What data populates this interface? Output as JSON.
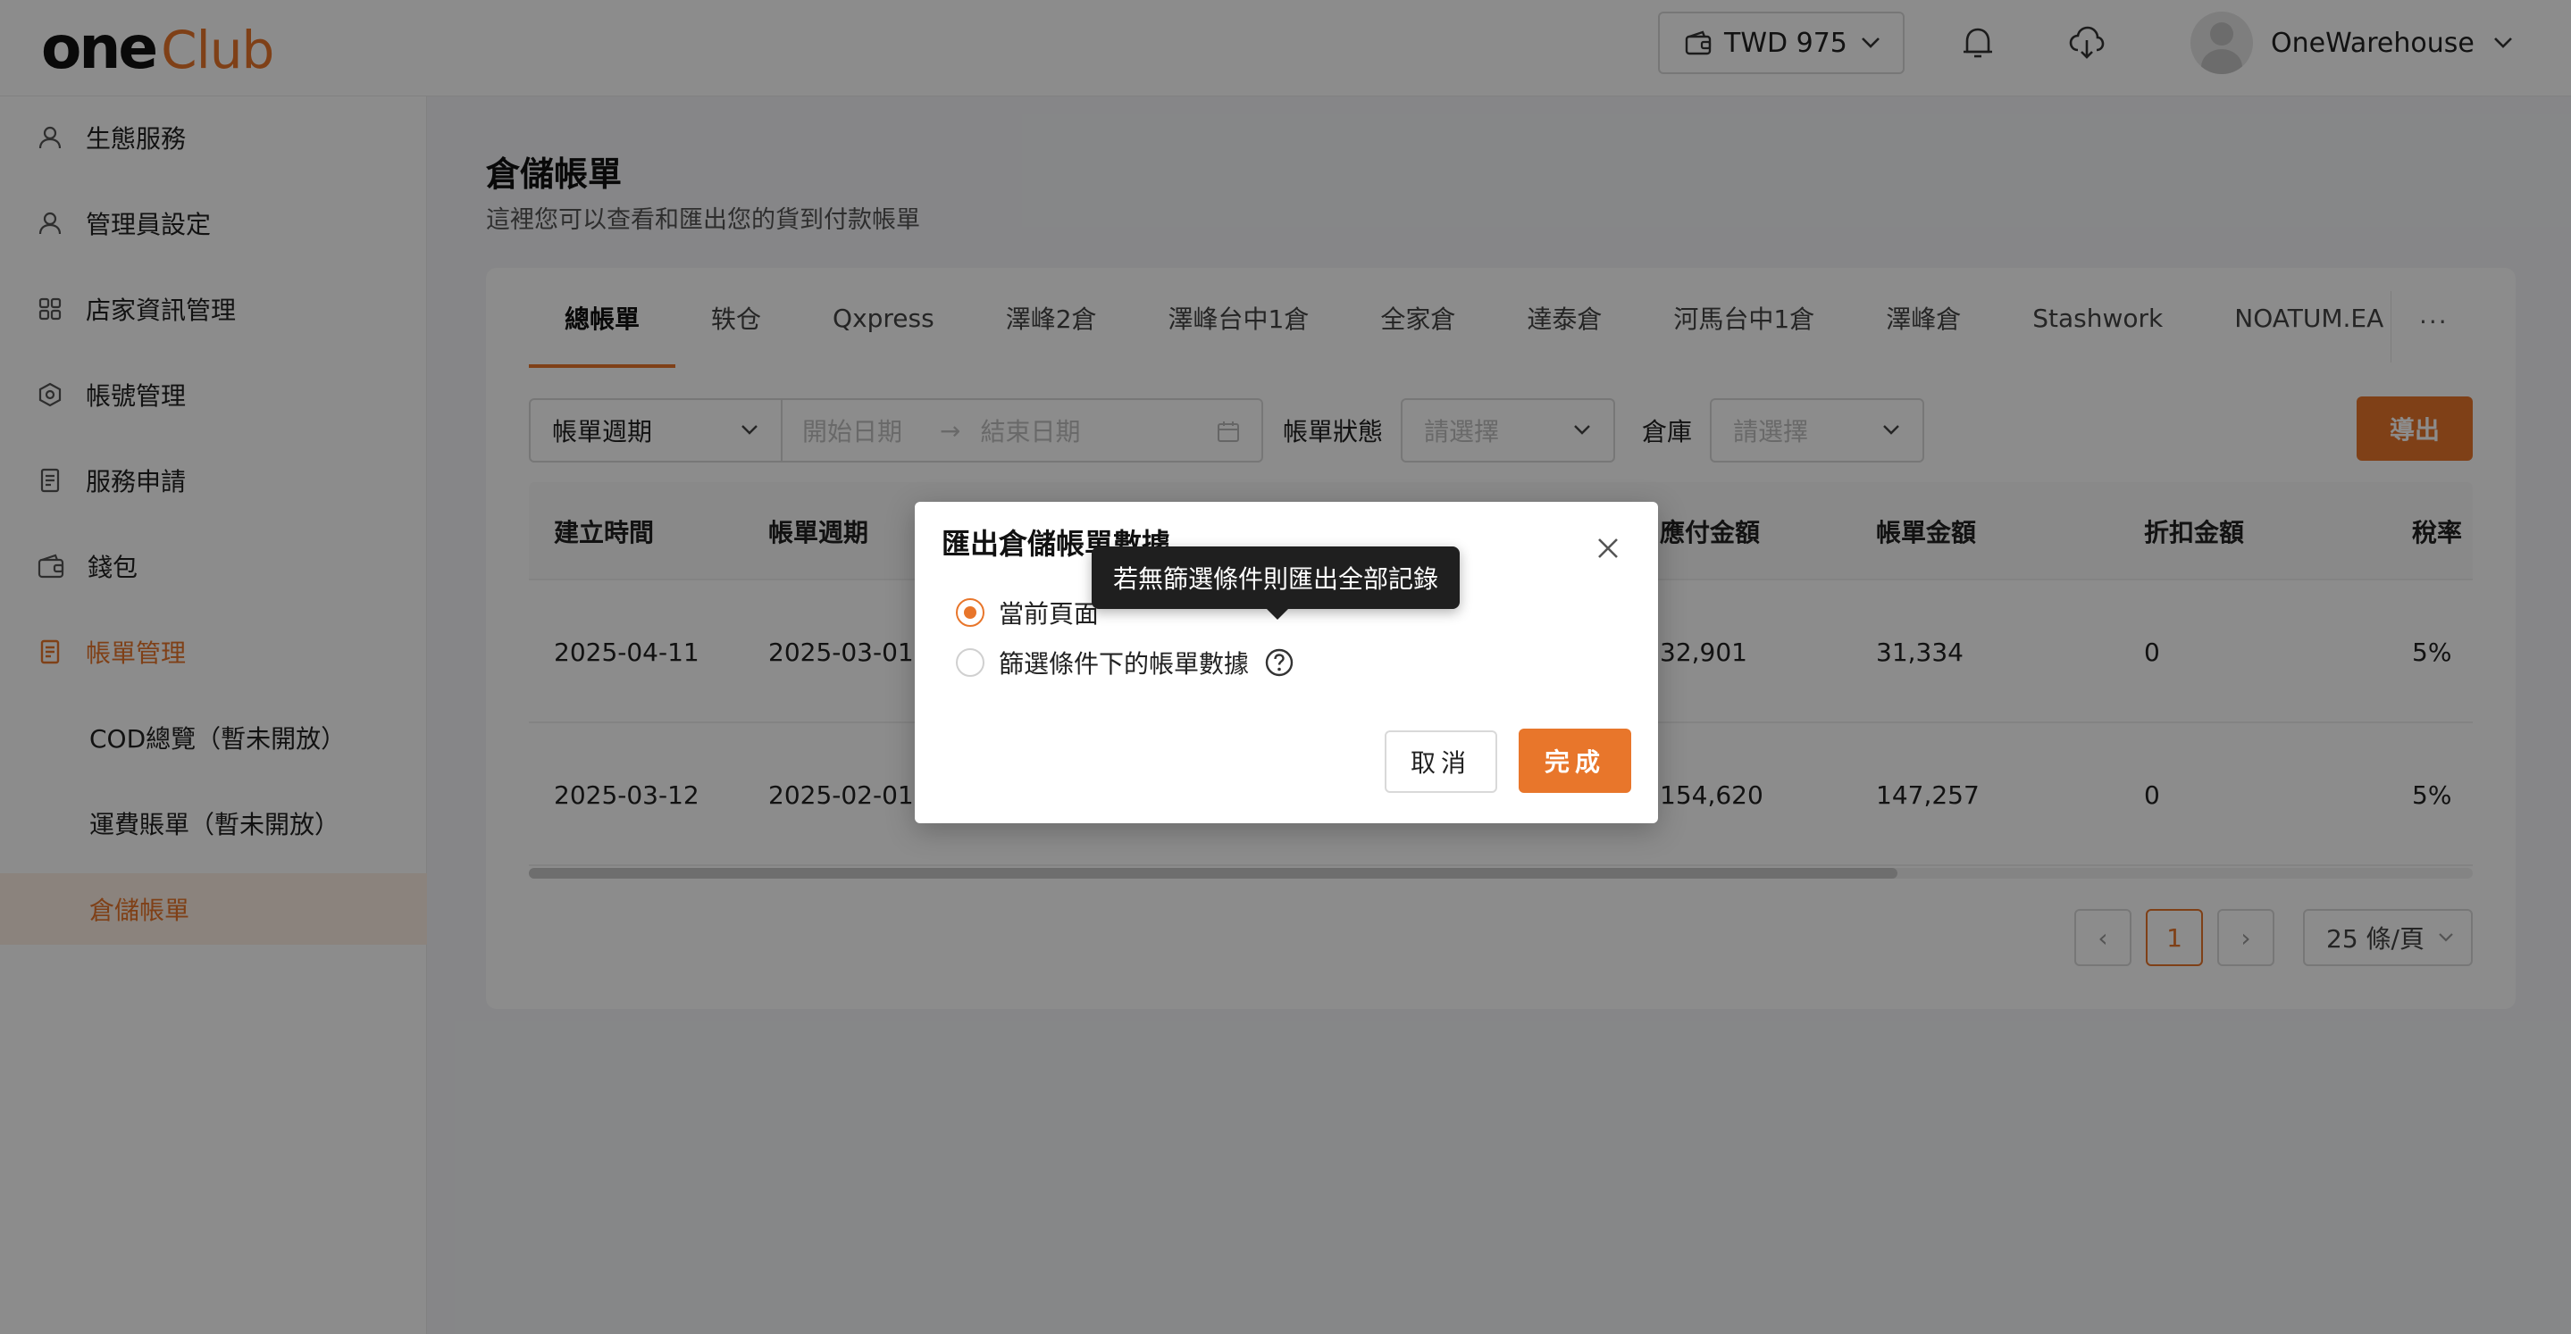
{
  "brand": {
    "logo_one": "one",
    "logo_club": "Club",
    "accent": "#e8762b"
  },
  "header": {
    "wallet_label": "TWD 975",
    "user_name": "OneWarehouse",
    "icons": [
      "wallet-icon",
      "bell-icon",
      "cloud-download-icon",
      "chevron-down-icon"
    ]
  },
  "sidebar": {
    "items": [
      {
        "label": "生態服務",
        "icon": "user-icon"
      },
      {
        "label": "管理員設定",
        "icon": "user-icon"
      },
      {
        "label": "店家資訊管理",
        "icon": "grid-icon"
      },
      {
        "label": "帳號管理",
        "icon": "hexagon-icon"
      },
      {
        "label": "服務申請",
        "icon": "document-icon"
      },
      {
        "label": "錢包",
        "icon": "wallet-icon"
      },
      {
        "label": "帳單管理",
        "icon": "bill-icon"
      }
    ],
    "subitems": [
      {
        "label": "COD總覽（暫未開放）"
      },
      {
        "label": "運費賬單（暫未開放）"
      },
      {
        "label": "倉儲帳單"
      }
    ]
  },
  "page": {
    "title": "倉儲帳單",
    "subtitle": "這裡您可以查看和匯出您的貨到付款帳單"
  },
  "tabs": [
    "總帳單",
    "轶仓",
    "Qxpress",
    "澤峰2倉",
    "澤峰台中1倉",
    "全家倉",
    "達泰倉",
    "河馬台中1倉",
    "澤峰倉",
    "Stashwork",
    "NOATUM.EA"
  ],
  "tabs_more": "···",
  "filters": {
    "period_select": "帳單週期",
    "start_placeholder": "開始日期",
    "end_placeholder": "結束日期",
    "arrow": "→",
    "status_label": "帳單狀態",
    "status_placeholder": "請選擇",
    "warehouse_label": "倉庫",
    "warehouse_placeholder": "請選擇",
    "export_button": "導出"
  },
  "table": {
    "columns": [
      "建立時間",
      "帳單週期",
      "應付金額",
      "帳單金額",
      "折扣金額",
      "稅率"
    ],
    "rows": [
      [
        "2025-04-11",
        "2025-03-01",
        "32,901",
        "31,334",
        "0",
        "5%"
      ],
      [
        "2025-03-12",
        "2025-02-01",
        "154,620",
        "147,257",
        "0",
        "5%"
      ]
    ]
  },
  "pagination": {
    "prev": "‹",
    "current": "1",
    "next": "›",
    "page_size": "25 條/頁"
  },
  "modal": {
    "title": "匯出倉儲帳單數據",
    "option_current": "當前頁面",
    "option_filtered": "篩選條件下的帳單數據",
    "tooltip": "若無篩選條件則匯出全部記錄",
    "cancel": "取消",
    "confirm": "完成"
  }
}
